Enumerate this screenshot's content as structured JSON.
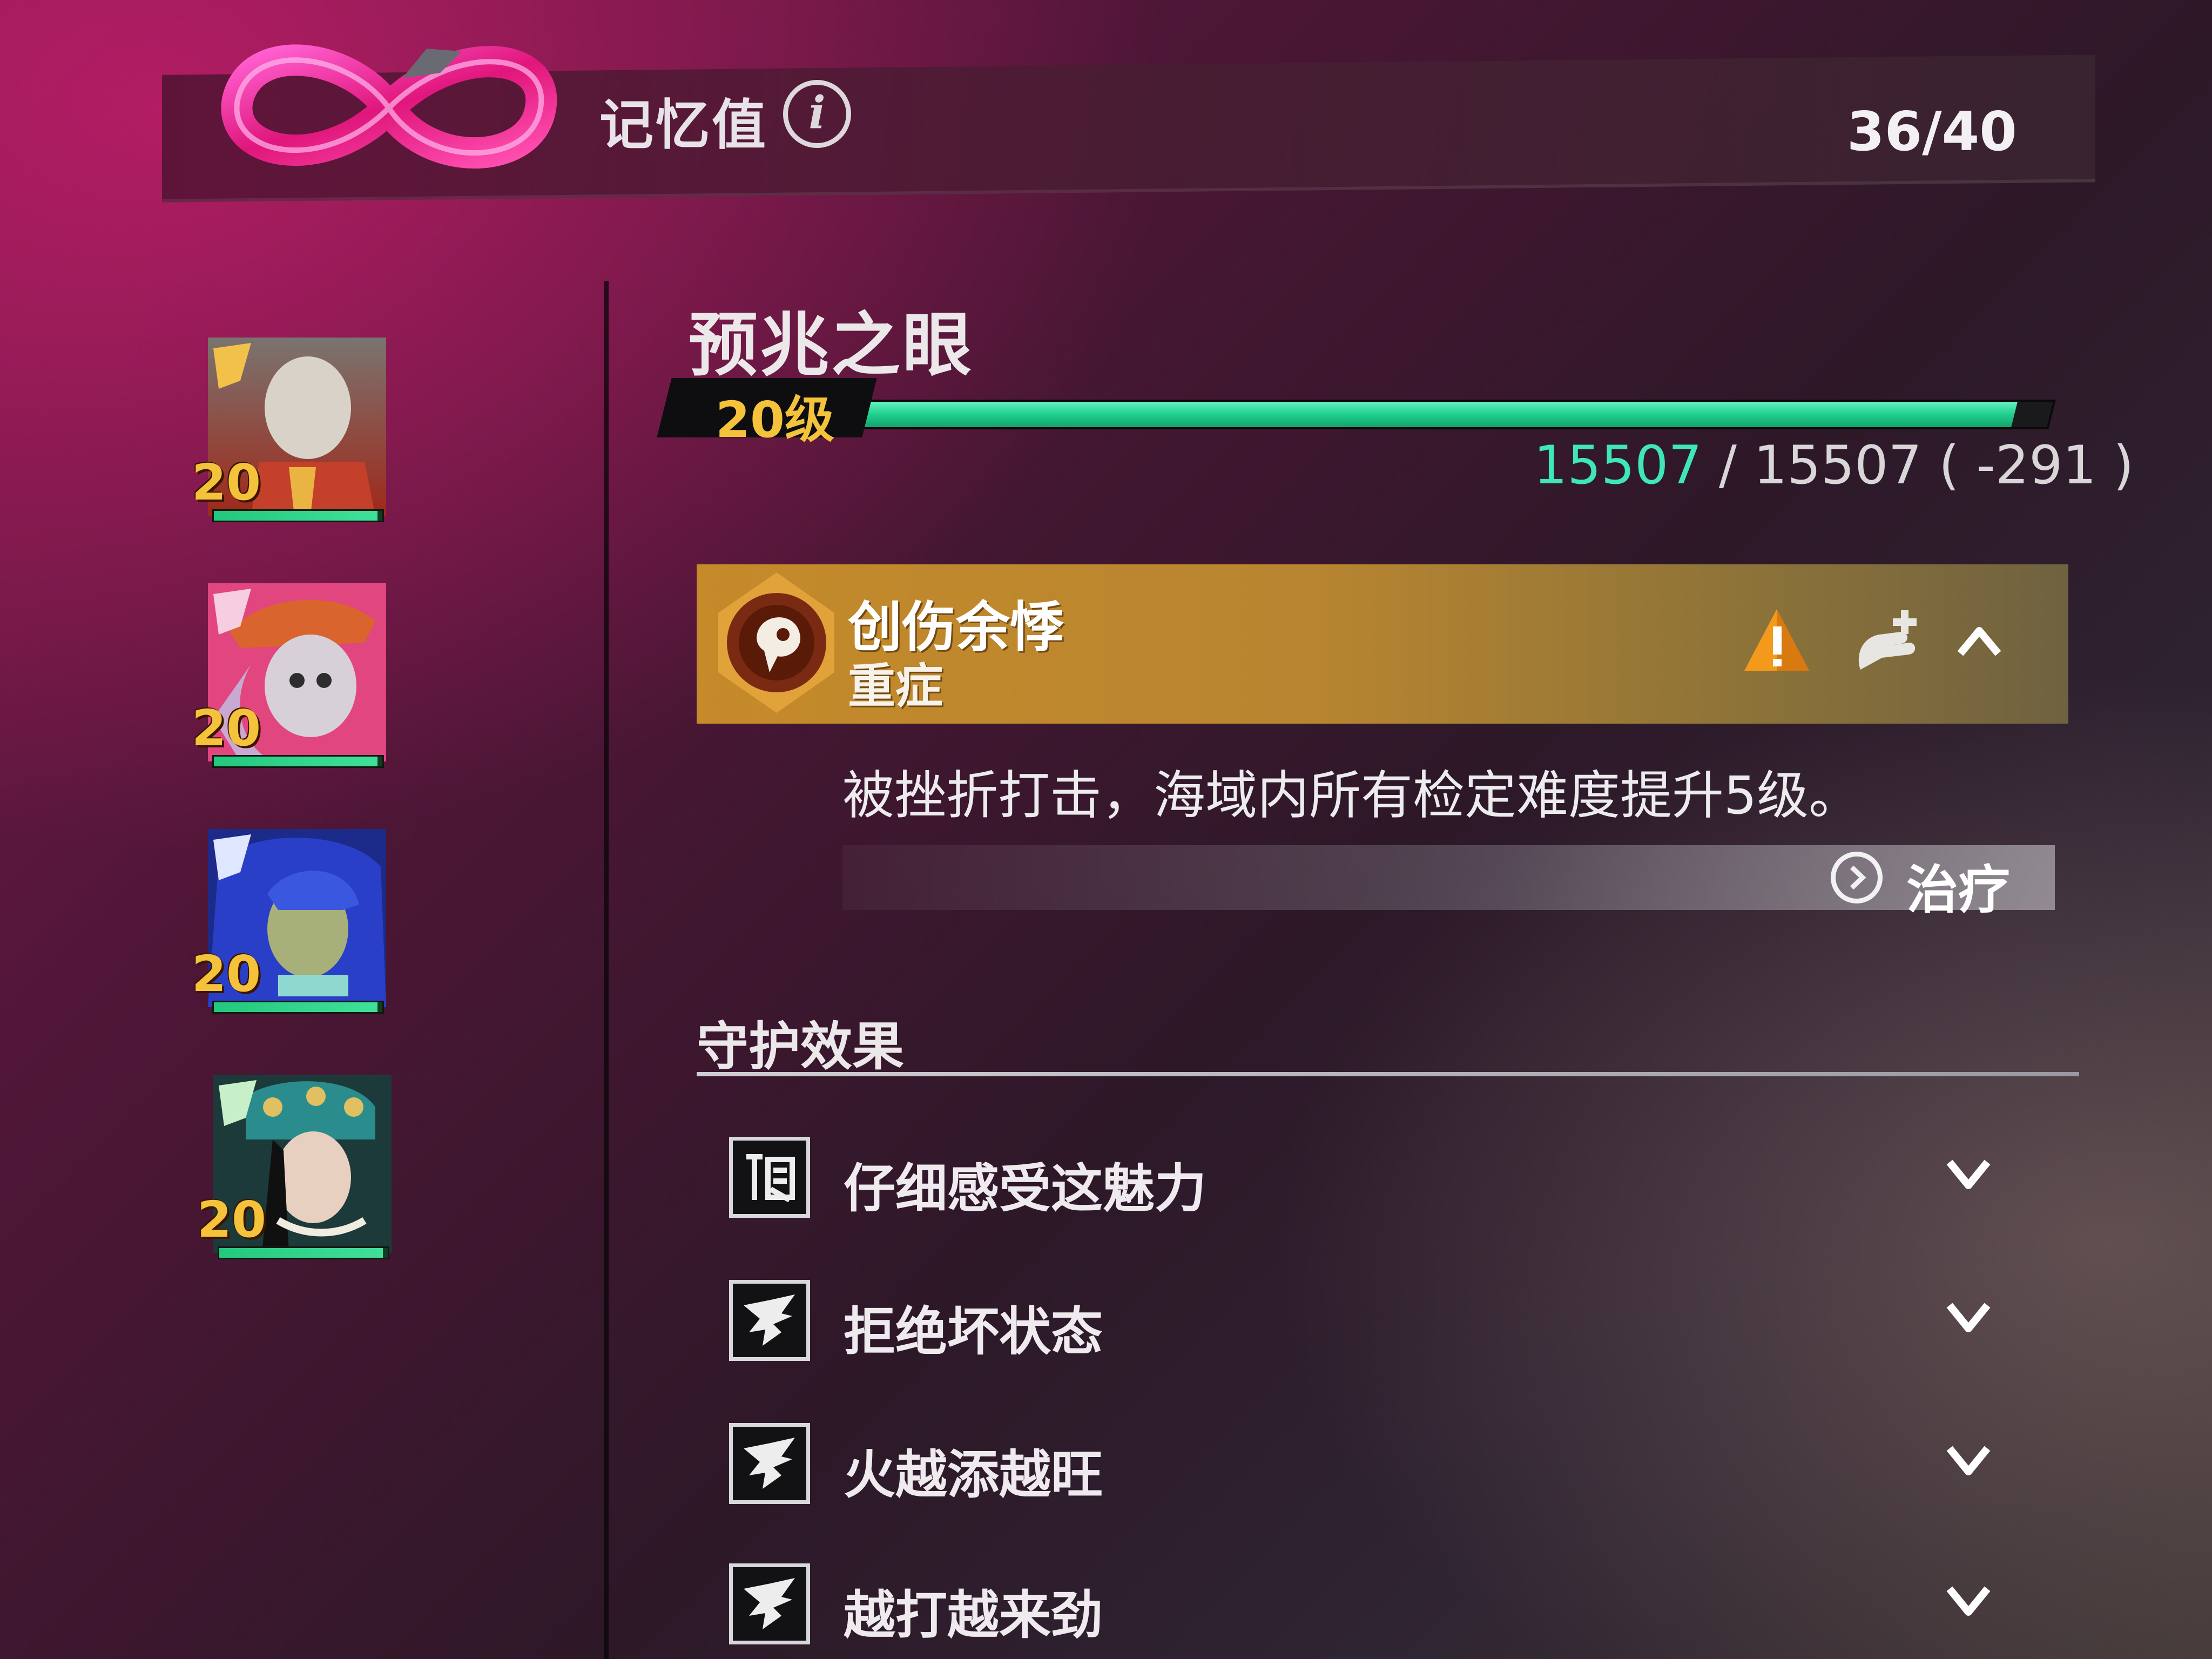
{
  "header": {
    "title": "记忆值",
    "info_glyph": "i",
    "counter": "36/40",
    "logo_icon": "infinity-loop-icon"
  },
  "roster": [
    {
      "level": "20",
      "hp_fraction": 0.97,
      "avatar": "portrait-old-gentleman"
    },
    {
      "level": "20",
      "hp_fraction": 0.97,
      "avatar": "portrait-hat-lady"
    },
    {
      "level": "20",
      "hp_fraction": 0.97,
      "avatar": "portrait-blue-hair"
    },
    {
      "level": "20",
      "hp_fraction": 0.97,
      "avatar": "portrait-opera-lady"
    }
  ],
  "character": {
    "name": "预兆之眼",
    "level_label": "20级",
    "exp_fraction": 0.97,
    "exp_current": "15507",
    "exp_rest": " / 15507 ( -291 )"
  },
  "status": {
    "name": "创伤余悸",
    "severity": "重症",
    "description": "被挫折打击，海域内所有检定难度提升5级。",
    "treat_label": "治疗",
    "colors": {
      "card": "#c58a2a",
      "accent": "#f5c23c"
    }
  },
  "guard": {
    "title": "守护效果",
    "effects": [
      {
        "label": "仔细感受这魅力",
        "icon": "charm-glyph-icon"
      },
      {
        "label": "拒绝坏状态",
        "icon": "wing-emblem-icon"
      },
      {
        "label": "火越添越旺",
        "icon": "wing-emblem-icon"
      },
      {
        "label": "越打越来劲",
        "icon": "wing-emblem-icon"
      }
    ]
  }
}
